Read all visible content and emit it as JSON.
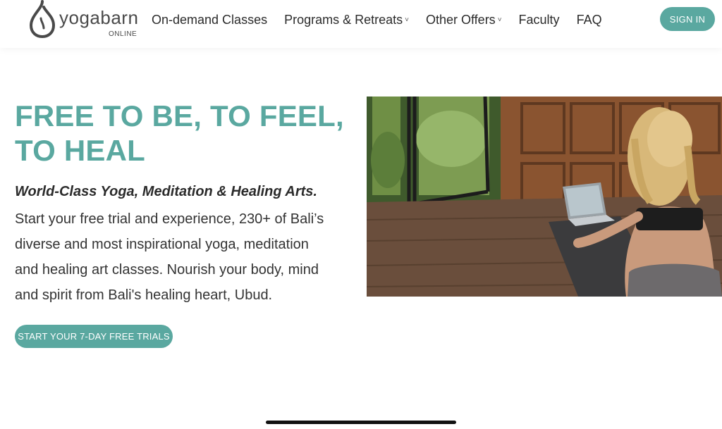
{
  "brand": {
    "name": "yogabarn",
    "tagline": "ONLINE",
    "accent": "#5aa8a0"
  },
  "nav": {
    "items": [
      {
        "label": "On-demand Classes",
        "has_dropdown": false
      },
      {
        "label": "Programs & Retreats",
        "has_dropdown": true
      },
      {
        "label": "Other Offers",
        "has_dropdown": true
      },
      {
        "label": "Faculty",
        "has_dropdown": false
      },
      {
        "label": "FAQ",
        "has_dropdown": false
      }
    ],
    "caret": "˅",
    "signin_label": "SIGN IN"
  },
  "hero": {
    "title_line1": "FREE TO BE, TO FEEL,",
    "title_line2": "TO HEAL",
    "subtitle": "World-Class Yoga, Meditation & Healing Arts.",
    "body_line1": "Start your free trial and experience, 230+ of Bali’s",
    "body_line2": "diverse and most inspirational yoga, meditation",
    "body_line3": "and healing art classes. Nourish your body, mind",
    "body_line4": "and spirit from Bali's healing heart, Ubud.",
    "cta_label": "START YOUR 7-DAY FREE TRIALS"
  },
  "icons": {
    "logo": "water-drop-icon",
    "dropdown": "chevron-down-icon"
  }
}
